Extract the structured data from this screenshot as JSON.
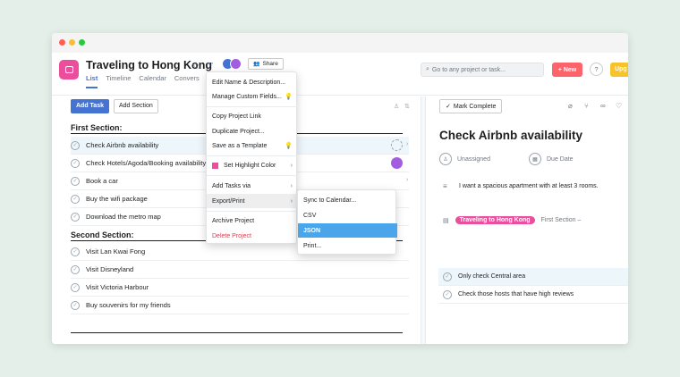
{
  "project": {
    "title": "Traveling to Hong Kong",
    "share_label": "Share",
    "tabs": [
      "List",
      "Timeline",
      "Calendar",
      "Convers"
    ]
  },
  "topbar": {
    "search_placeholder": "Go to any project or task...",
    "new_label": "New",
    "help_label": "?",
    "upgrade_label": "Upg"
  },
  "toolbar": {
    "add_task_label": "Add Task",
    "add_section_label": "Add Section"
  },
  "sections": [
    {
      "title": "First Section:",
      "tasks": [
        {
          "name": "Check Airbnb availability"
        },
        {
          "name": "Check Hotels/Agoda/Booking availability"
        },
        {
          "name": "Book a car"
        },
        {
          "name": "Buy the wifi package"
        },
        {
          "name": "Download the metro map"
        }
      ]
    },
    {
      "title": "Second Section:",
      "tasks": [
        {
          "name": "Visit Lan Kwai Fong"
        },
        {
          "name": "Visit Disneyland"
        },
        {
          "name": "Visit Victoria Harbour"
        },
        {
          "name": "Buy souvenirs for my friends"
        }
      ]
    }
  ],
  "detail": {
    "mark_complete_label": "Mark Complete",
    "title": "Check Airbnb availability",
    "assignee_label": "Unassigned",
    "due_label": "Due Date",
    "description": "I want a spacious apartment with at least 3 rooms.",
    "project_pill": "Traveling to Hong Kong",
    "section_link": "First Section –",
    "subtasks": [
      "Only check Central area",
      "Check those hosts that have high reviews"
    ]
  },
  "menu": {
    "items": [
      "Edit Name & Description...",
      "Manage Custom Fields...",
      "Copy Project Link",
      "Duplicate Project...",
      "Save as a Template",
      "Set Highlight Color",
      "Add Tasks via",
      "Export/Print",
      "Archive Project",
      "Delete Project"
    ]
  },
  "submenu": {
    "items": [
      "Sync to Calendar...",
      "CSV",
      "JSON",
      "Print..."
    ],
    "selected": "JSON"
  },
  "colors": {
    "accent": "#4573d2",
    "project": "#ea4e9d",
    "danger": "#e8384f",
    "selected": "#4ba5eb",
    "new_button": "#fc636b",
    "upgrade": "#f8c32a"
  }
}
